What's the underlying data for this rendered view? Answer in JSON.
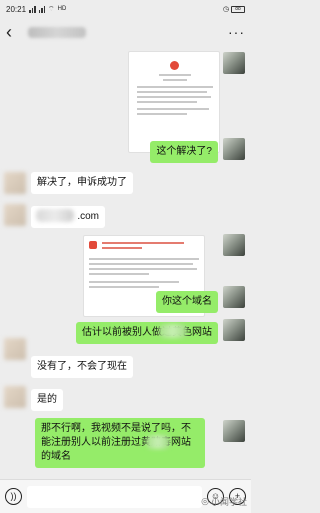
{
  "status_bar": {
    "time": "20:21",
    "network_text": "HD",
    "battery": "88"
  },
  "header": {
    "back_icon": "chevron-left-icon",
    "more_icon": "more-dots-icon",
    "more_glyph": "···"
  },
  "messages": [
    {
      "side": "mine",
      "type": "image",
      "icon": "document-screenshot"
    },
    {
      "side": "mine",
      "type": "text",
      "text": "这个解决了?"
    },
    {
      "side": "other",
      "type": "text",
      "text": "解决了，申诉成功了"
    },
    {
      "side": "other",
      "type": "text",
      "text": ".com",
      "redacted": true
    },
    {
      "side": "mine",
      "type": "image",
      "icon": "notice-screenshot"
    },
    {
      "side": "mine",
      "type": "text",
      "text": "你这个域名"
    },
    {
      "side": "mine",
      "type": "text",
      "text": "估计以前被别人做过黄色网站"
    },
    {
      "side": "other",
      "type": "text",
      "text": "没有了，不会了现在"
    },
    {
      "side": "other",
      "type": "text",
      "text": "是的"
    },
    {
      "side": "mine",
      "type": "text",
      "text": "那不行啊，我视频不是说了吗，不能注册别人以前注册过黄赌毒网站的域名"
    }
  ],
  "input_bar": {
    "voice_icon": "voice-icon",
    "emoji_icon": "emoji-icon",
    "plus_icon": "plus-icon",
    "plus_glyph": "+"
  },
  "watermark": {
    "icon": "wechat-logo-icon",
    "text": "小闻学社"
  },
  "colors": {
    "mine_bubble": "#95ec69",
    "other_bubble": "#ffffff",
    "background": "#ededed"
  }
}
